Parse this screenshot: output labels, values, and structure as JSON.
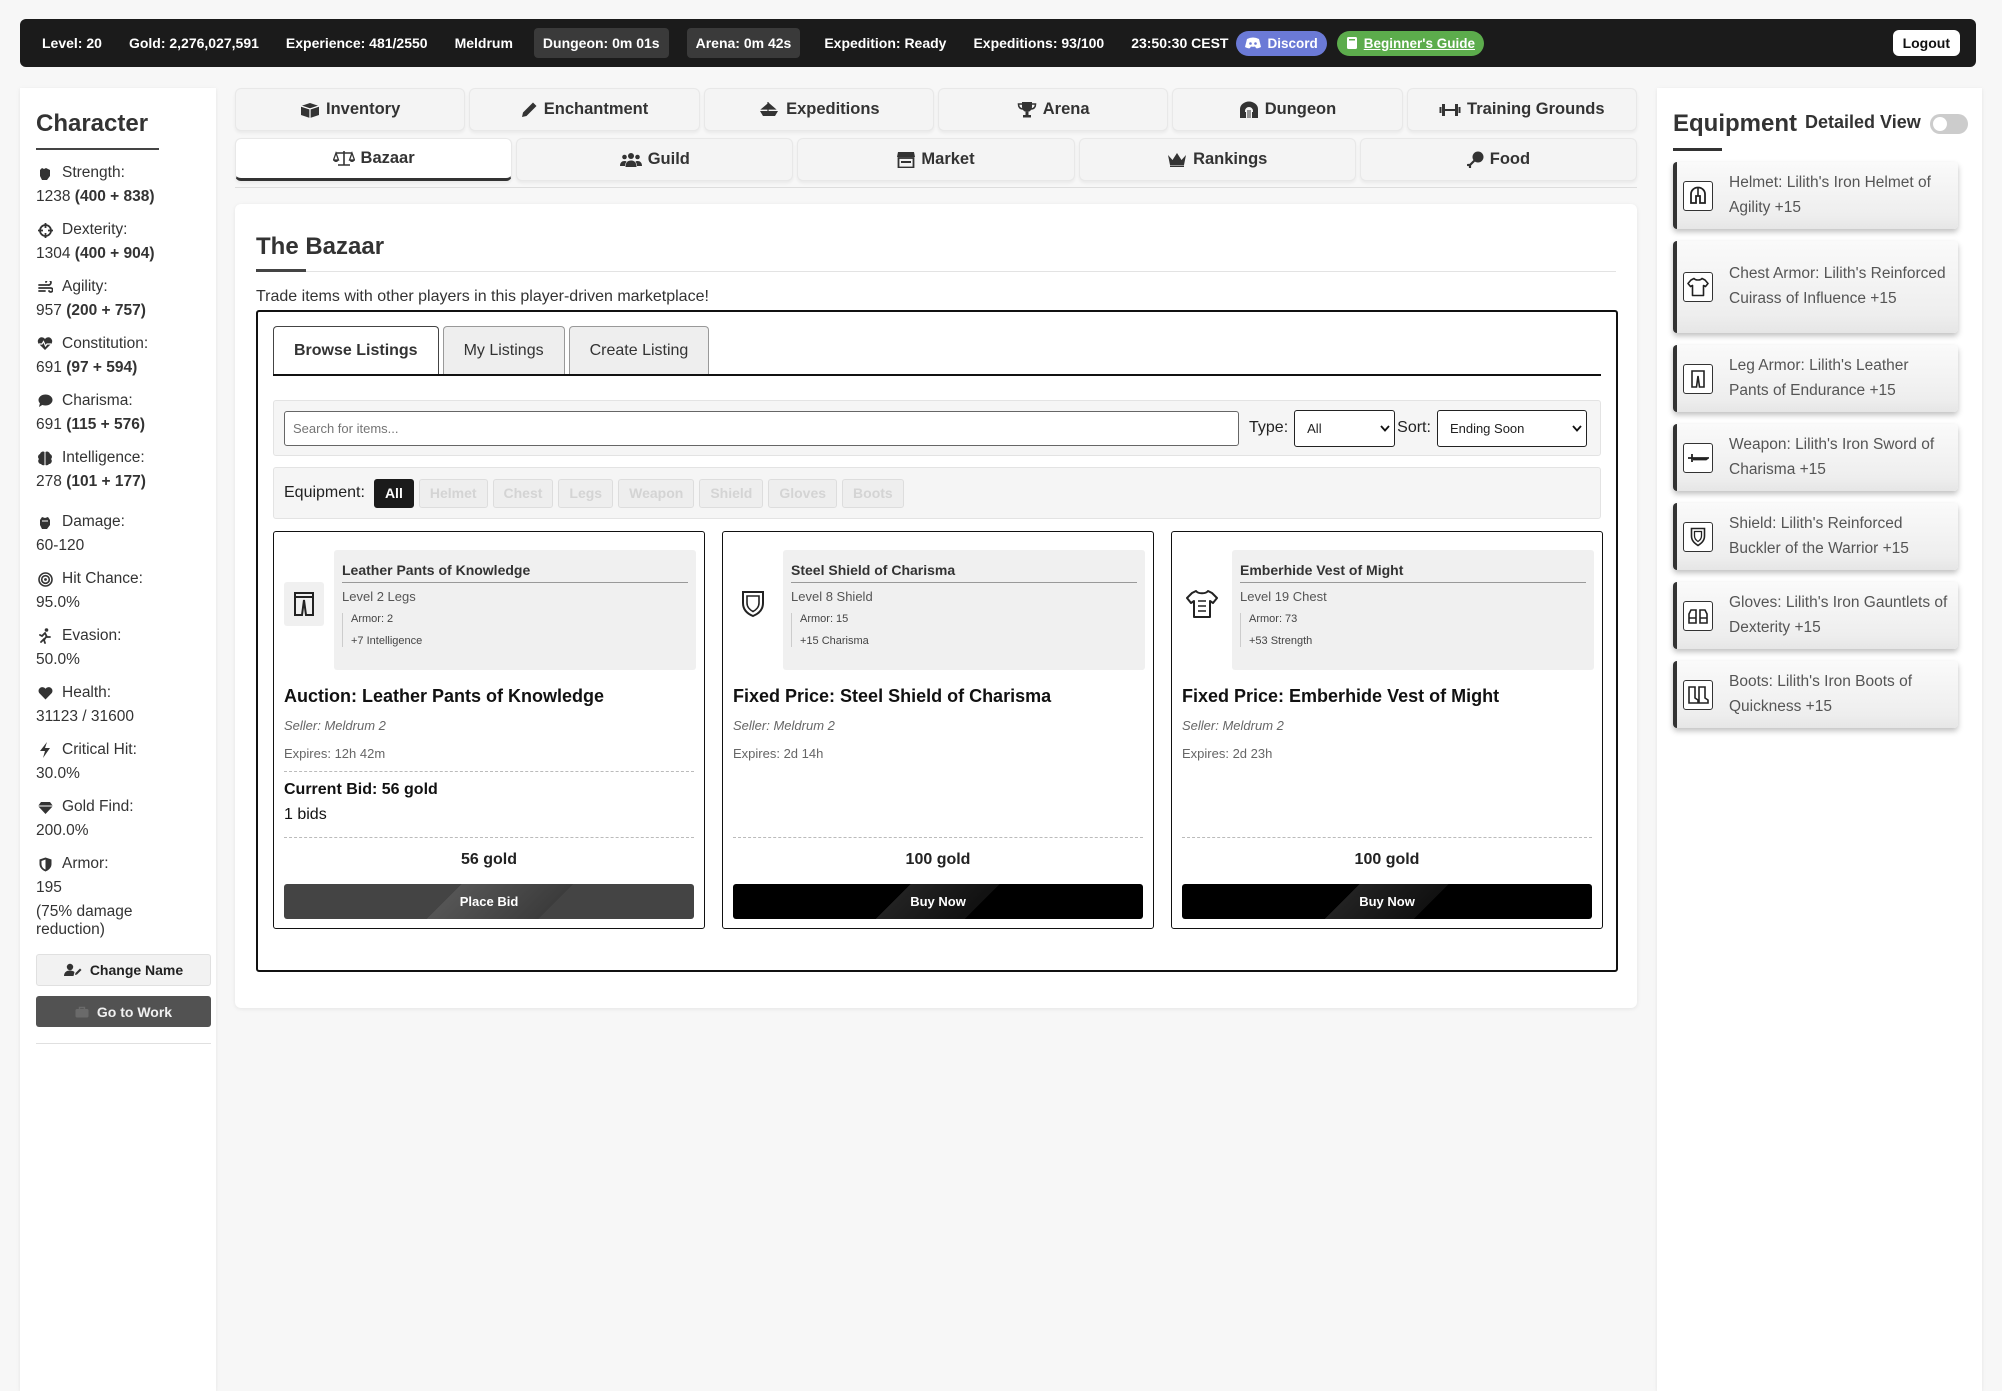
{
  "topbar": {
    "level": "Level: 20",
    "gold": "Gold: 2,276,027,591",
    "experience": "Experience: 481/2550",
    "player": "Meldrum",
    "dungeon_timer": "Dungeon: 0m 01s",
    "arena_timer": "Arena: 0m 42s",
    "expedition": "Expedition: Ready",
    "expeditions": "Expeditions: 93/100",
    "clock": "23:50:30 CEST",
    "discord": "Discord",
    "guide": "Beginner's Guide",
    "logout": "Logout"
  },
  "character": {
    "title": "Character",
    "stats": [
      {
        "name": "Strength:",
        "value": "1238",
        "detail": "(400 + 838)",
        "icon": "fist-icon"
      },
      {
        "name": "Dexterity:",
        "value": "1304",
        "detail": "(400 + 904)",
        "icon": "crosshair-icon"
      },
      {
        "name": "Agility:",
        "value": "957",
        "detail": "(200 + 757)",
        "icon": "wind-icon"
      },
      {
        "name": "Constitution:",
        "value": "691",
        "detail": "(97 + 594)",
        "icon": "heartbeat-icon"
      },
      {
        "name": "Charisma:",
        "value": "691",
        "detail": "(115 + 576)",
        "icon": "speech-icon"
      },
      {
        "name": "Intelligence:",
        "value": "278",
        "detail": "(101 + 177)",
        "icon": "brain-icon"
      },
      {
        "name": "Damage:",
        "value": "60-120",
        "detail": "",
        "icon": "fist-icon"
      },
      {
        "name": "Hit Chance:",
        "value": "95.0%",
        "detail": "",
        "icon": "target-icon"
      },
      {
        "name": "Evasion:",
        "value": "50.0%",
        "detail": "",
        "icon": "runner-icon"
      },
      {
        "name": "Health:",
        "value": "31123 / 31600",
        "detail": "",
        "icon": "heart-icon"
      },
      {
        "name": "Critical Hit:",
        "value": "30.0%",
        "detail": "",
        "icon": "bolt-icon"
      },
      {
        "name": "Gold Find:",
        "value": "200.0%",
        "detail": "",
        "icon": "gem-icon"
      },
      {
        "name": "Armor:",
        "value": "195",
        "detail": "",
        "icon": "shield-icon"
      }
    ],
    "armor_note": "(75% damage reduction)",
    "change_name": "Change Name",
    "go_to_work": "Go to Work"
  },
  "nav": {
    "row1": [
      {
        "label": "Inventory",
        "icon": "box-icon"
      },
      {
        "label": "Enchantment",
        "icon": "pencil-icon"
      },
      {
        "label": "Expeditions",
        "icon": "ship-icon"
      },
      {
        "label": "Arena",
        "icon": "trophy-icon"
      },
      {
        "label": "Dungeon",
        "icon": "dungeon-icon"
      },
      {
        "label": "Training Grounds",
        "icon": "dumbbell-icon"
      }
    ],
    "row2": [
      {
        "label": "Bazaar",
        "icon": "scales-icon",
        "active": true
      },
      {
        "label": "Guild",
        "icon": "users-icon"
      },
      {
        "label": "Market",
        "icon": "store-icon"
      },
      {
        "label": "Rankings",
        "icon": "crown-icon"
      },
      {
        "label": "Food",
        "icon": "drumstick-icon"
      }
    ]
  },
  "bazaar": {
    "title": "The Bazaar",
    "description": "Trade items with other players in this player-driven marketplace!",
    "tabs": [
      "Browse Listings",
      "My Listings",
      "Create Listing"
    ],
    "search_placeholder": "Search for items...",
    "type_label": "Type:",
    "type_value": "All",
    "sort_label": "Sort:",
    "sort_value": "Ending Soon",
    "equipment_label": "Equipment:",
    "equipment_filters": [
      "All",
      "Helmet",
      "Chest",
      "Legs",
      "Weapon",
      "Shield",
      "Gloves",
      "Boots"
    ],
    "listings": [
      {
        "item_name": "Leather Pants of Knowledge",
        "item_level": "Level 2 Legs",
        "item_armor": "Armor: 2",
        "item_bonus": "+7 Intelligence",
        "icon": "pants-icon",
        "title": "Auction: Leather Pants of Knowledge",
        "seller": "Seller: Meldrum 2",
        "expires": "Expires: 12h 42m",
        "current_bid": "Current Bid: 56 gold",
        "bids": "1 bids",
        "price": "56 gold",
        "button": "Place Bid"
      },
      {
        "item_name": "Steel Shield of Charisma",
        "item_level": "Level 8 Shield",
        "item_armor": "Armor: 15",
        "item_bonus": "+15 Charisma",
        "icon": "shield-icon",
        "title": "Fixed Price: Steel Shield of Charisma",
        "seller": "Seller: Meldrum 2",
        "expires": "Expires: 2d 14h",
        "price": "100 gold",
        "button": "Buy Now"
      },
      {
        "item_name": "Emberhide Vest of Might",
        "item_level": "Level 19 Chest",
        "item_armor": "Armor: 73",
        "item_bonus": "+53 Strength",
        "icon": "vest-icon",
        "title": "Fixed Price: Emberhide Vest of Might",
        "seller": "Seller: Meldrum 2",
        "expires": "Expires: 2d 23h",
        "price": "100 gold",
        "button": "Buy Now"
      }
    ]
  },
  "equipment": {
    "title": "Equipment",
    "detailed_view": "Detailed View",
    "items": [
      {
        "text": "Helmet: Lilith's Iron Helmet of Agility +15",
        "icon": "helmet-icon"
      },
      {
        "text": "Chest Armor: Lilith's Reinforced Cuirass of Influence +15",
        "icon": "chest-armor-icon"
      },
      {
        "text": "Leg Armor: Lilith's Leather Pants of Endurance +15",
        "icon": "pants-icon"
      },
      {
        "text": "Weapon: Lilith's Iron Sword of Charisma +15",
        "icon": "sword-icon"
      },
      {
        "text": "Shield: Lilith's Reinforced Buckler of the Warrior +15",
        "icon": "shield-icon"
      },
      {
        "text": "Gloves: Lilith's Iron Gauntlets of Dexterity +15",
        "icon": "gloves-icon"
      },
      {
        "text": "Boots: Lilith's Iron Boots of Quickness +15",
        "icon": "boots-icon"
      }
    ]
  }
}
